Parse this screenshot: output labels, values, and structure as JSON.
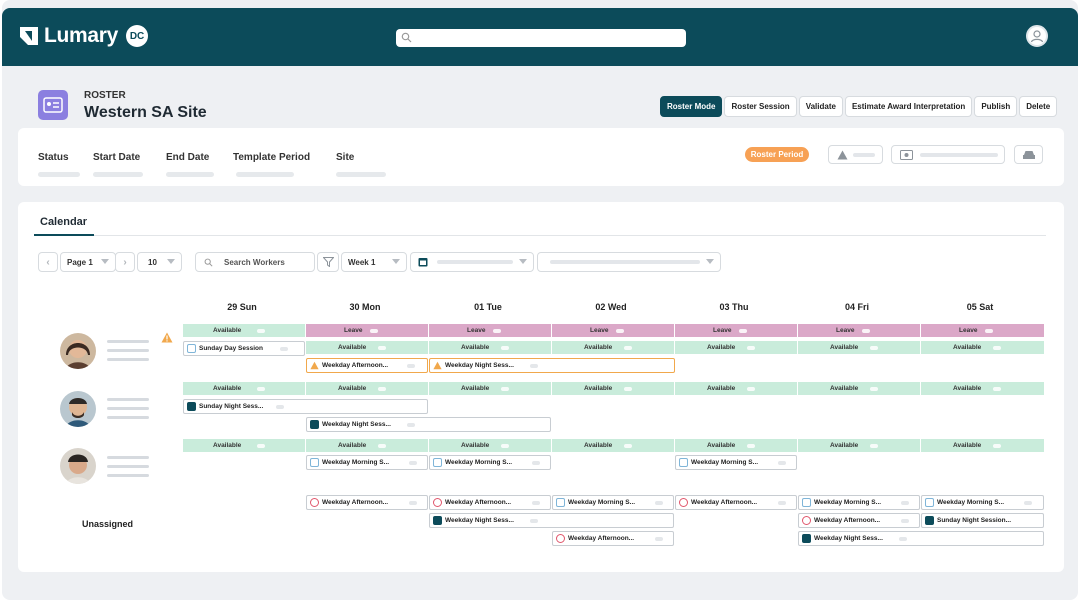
{
  "app": {
    "name": "Lumary",
    "badge": "DC"
  },
  "header": {
    "crumb": "ROSTER",
    "title": "Western SA Site"
  },
  "actions": [
    "Roster Mode",
    "Roster Session",
    "Validate",
    "Estimate Award Interpretation",
    "Publish",
    "Delete"
  ],
  "info": {
    "fields": [
      "Status",
      "Start Date",
      "End Date",
      "Template Period",
      "Site"
    ],
    "period_badge": "Roster Period"
  },
  "calendar": {
    "tab": "Calendar",
    "page": "Page 1",
    "page_size": "10",
    "search_placeholder": "Search Workers",
    "week": "Week 1",
    "days": [
      "29 Sun",
      "30 Mon",
      "01 Tue",
      "02 Wed",
      "03 Thu",
      "04 Fri",
      "05 Sat"
    ],
    "unassigned_label": "Unassigned",
    "strip_labels": {
      "available": "Available",
      "leave": "Leave"
    },
    "shifts": {
      "sunday_day": "Sunday Day Session",
      "weekday_afternoon": "Weekday Afternoon...",
      "weekday_night_sess": "Weekday Night Sess...",
      "sunday_night_sess": "Sunday Night Sess...",
      "weekday_night_sess2": "Weekday Night Sess...",
      "weekday_morning_s": "Weekday Morning S...",
      "weekday_afternoon_u": "Weekday Afternoon...",
      "weekday_morning_s2": "Weekday Morning S...",
      "weekday_afternoon_u2": "Weekday Afternoon...",
      "weekday_night_sess_u": "Weekday Night Sess...",
      "weekday_afternoon_u3": "Weekday Afternoon...",
      "weekday_afternoon_u4": "Weekday Afternoon...",
      "sunday_night_session": "Sunday Night Session..."
    }
  },
  "colors": {
    "brand": "#0c4b5a",
    "available": "#c9ecdb",
    "leave": "#dba8c8",
    "warning": "#f1a84c",
    "badge": "#f7a155"
  }
}
